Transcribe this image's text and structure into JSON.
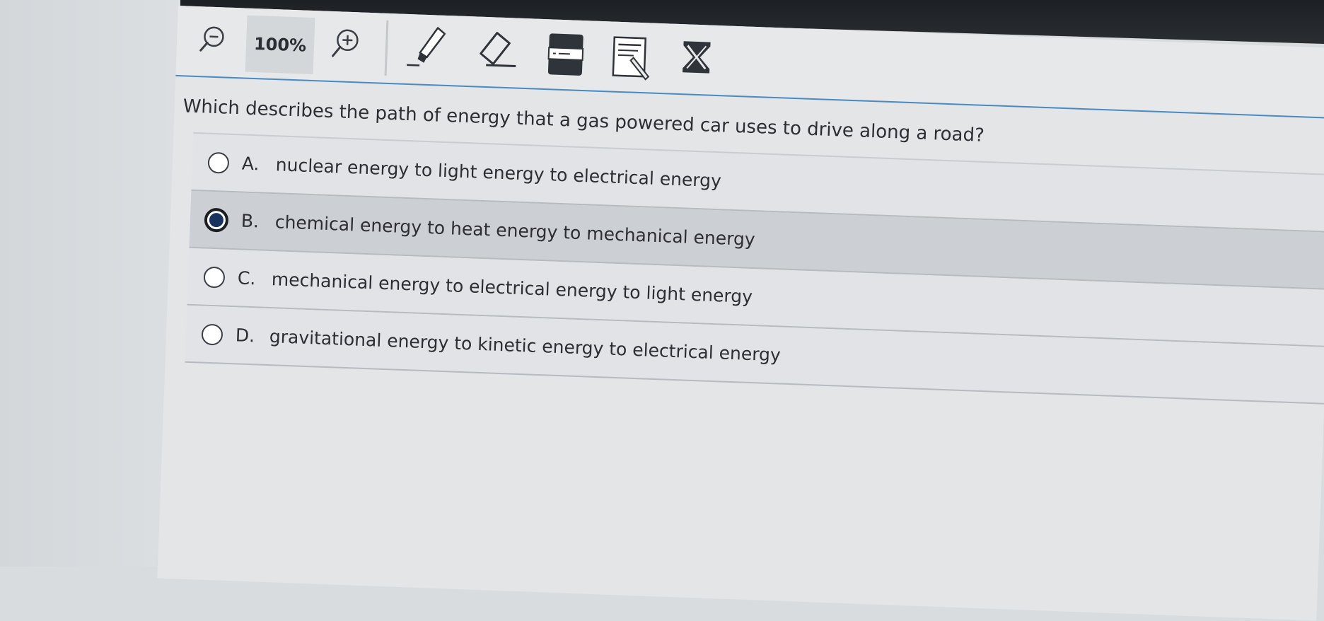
{
  "toolbar": {
    "zoom_level": "100%",
    "icons": {
      "zoom_out": "zoom-out-icon",
      "zoom_in": "zoom-in-icon",
      "highlighter": "highlighter-icon",
      "eraser": "eraser-icon",
      "line_reader": "line-reader-icon",
      "notepad": "notepad-icon",
      "answer_masking": "answer-masking-icon"
    }
  },
  "question": {
    "text": "Which describes the path of energy that a gas powered car uses to drive along a road?",
    "options": [
      {
        "letter": "A.",
        "text": "nuclear energy to light energy to electrical energy",
        "selected": false
      },
      {
        "letter": "B.",
        "text": "chemical energy to heat energy to mechanical energy",
        "selected": true
      },
      {
        "letter": "C.",
        "text": "mechanical energy to electrical energy to light energy",
        "selected": false
      },
      {
        "letter": "D.",
        "text": "gravitational energy to kinetic energy to electrical energy",
        "selected": false
      }
    ]
  },
  "colors": {
    "accent_line": "#4a8ac1",
    "selected_radio": "#16325f",
    "selected_row": "#cccfd3"
  }
}
